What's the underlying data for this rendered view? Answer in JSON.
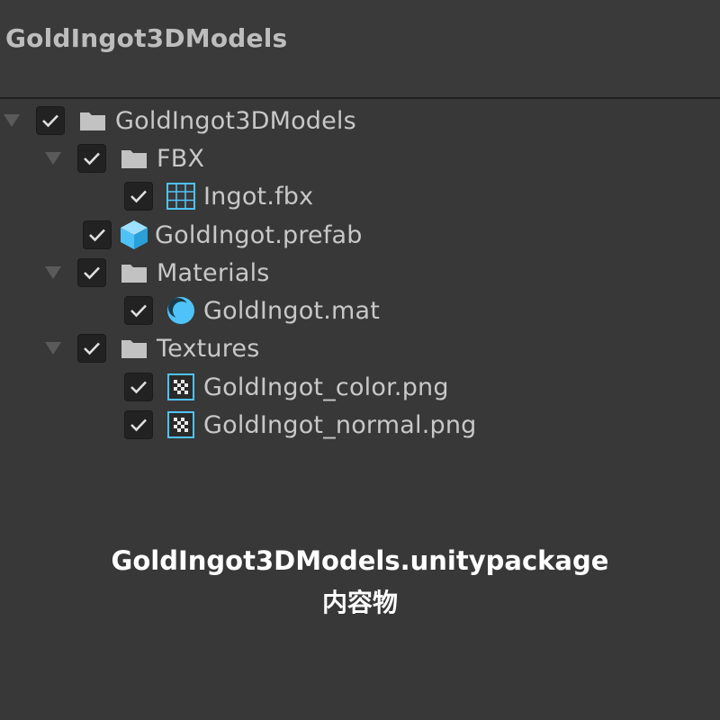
{
  "window": {
    "title": "GoldIngot3DModels"
  },
  "tree": {
    "root": {
      "label": "GoldIngot3DModels",
      "checked": true,
      "icon": "folder-icon"
    },
    "fbx_folder": {
      "label": "FBX",
      "checked": true,
      "icon": "folder-icon"
    },
    "ingot_fbx": {
      "label": "Ingot.fbx",
      "checked": true,
      "icon": "mesh-grid-icon"
    },
    "prefab": {
      "label": "GoldIngot.prefab",
      "checked": true,
      "icon": "prefab-cube-icon"
    },
    "materials_folder": {
      "label": "Materials",
      "checked": true,
      "icon": "folder-icon"
    },
    "material": {
      "label": "GoldIngot.mat",
      "checked": true,
      "icon": "material-sphere-icon"
    },
    "textures_folder": {
      "label": "Textures",
      "checked": true,
      "icon": "folder-icon"
    },
    "color_png": {
      "label": "GoldIngot_color.png",
      "checked": true,
      "icon": "texture-icon"
    },
    "normal_png": {
      "label": "GoldIngot_normal.png",
      "checked": true,
      "icon": "texture-icon"
    }
  },
  "caption": {
    "line1": "GoldIngot3DModels.unitypackage",
    "line2": "内容物"
  },
  "colors": {
    "background": "#383838",
    "text": "#c8c8c8",
    "accent_blue": "#4fc3f7",
    "checkbox_bg": "#222222"
  }
}
